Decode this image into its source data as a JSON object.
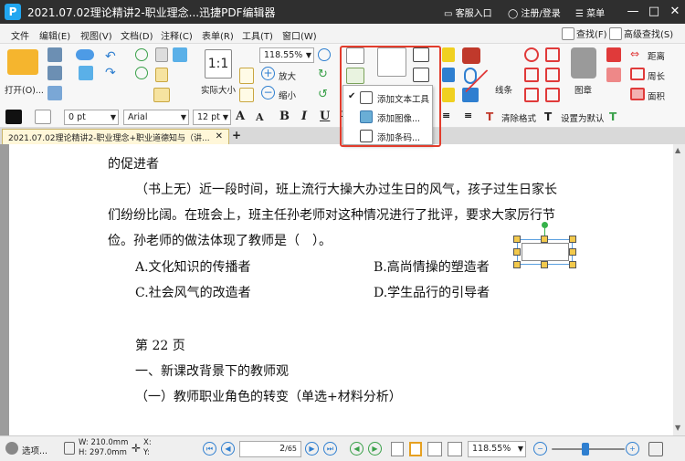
{
  "titlebar": {
    "logo": "P",
    "title": "2021.07.02理论精讲2-职业理念...迅捷PDF编辑器",
    "service": "客服入口",
    "login": "注册/登录",
    "menu": "菜单"
  },
  "menubar": {
    "items": [
      "文件",
      "编辑(E)",
      "视图(V)",
      "文档(D)",
      "注释(C)",
      "表单(R)",
      "工具(T)",
      "窗口(W)"
    ],
    "find": "查找(F)",
    "advanced_find": "高级查找(S)"
  },
  "ribbon": {
    "open_label": "打开(O)...",
    "zoom_value": "118.55%",
    "actual_size": "实际大小",
    "zoom_in": "放大",
    "zoom_out": "缩小",
    "line_label": "线条",
    "stamp_label": "图章",
    "distance": "距离",
    "perimeter": "周长",
    "area": "面积"
  },
  "fmtbar": {
    "line_width": "0 pt",
    "font": "Arial",
    "font_size": "12 pt",
    "clear_format": "清除格式",
    "set_default": "设置为默认"
  },
  "doc_tab": {
    "label": "2021.07.02理论精讲2-职业理念+职业道德知与（讲...",
    "close": "✕",
    "new": "+"
  },
  "dropdown": {
    "items": [
      "添加文本工具",
      "添加图像...",
      "添加条码..."
    ]
  },
  "document": {
    "lines": [
      "的促进者",
      "（书上无）近一段时间，班上流行大操大办过生日的风气，孩子过生日家长",
      "们纷纷比阔。在班会上，班主任孙老师对这种情况进行了批评，要求大家厉行节",
      "俭。孙老师的做法体现了教师是（　）。"
    ],
    "options": {
      "a": "A.文化知识的传播者",
      "b": "B.高尚情操的塑造者",
      "c": "C.社会风气的改造者",
      "d": "D.学生品行的引导者"
    },
    "page_heading": "第 22 页",
    "section": "一、新课改背景下的教师观",
    "subsection": "（一）教师职业角色的转变（单选+材料分析）"
  },
  "statusbar": {
    "options_label": "选项...",
    "width": "W: 210.0mm",
    "height": "H: 297.0mm",
    "x": "X:",
    "y": "Y:",
    "page_current": "2",
    "page_total": "/65",
    "zoom": "118.55%"
  }
}
